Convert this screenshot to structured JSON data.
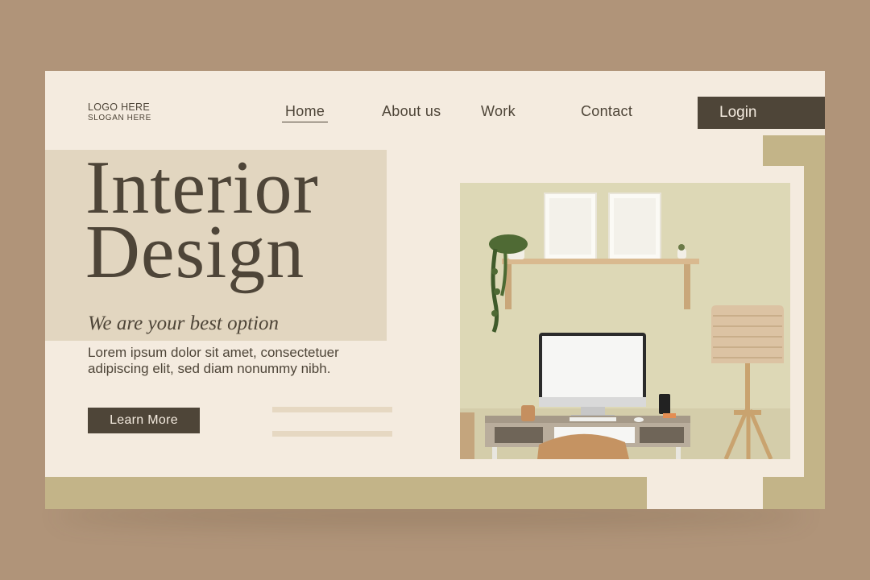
{
  "logo": {
    "line1": "LOGO HERE",
    "line2": "SLOGAN HERE"
  },
  "nav": {
    "home": "Home",
    "about": "About us",
    "work": "Work",
    "contact": "Contact"
  },
  "login_label": "Login",
  "hero": {
    "title_line1": "Interior",
    "title_line2": "Design",
    "tagline": "We are your best option",
    "description": "Lorem ipsum dolor sit amet, consectetuer adipiscing elit, sed diam nonummy nibh.",
    "cta_label": "Learn More"
  },
  "colors": {
    "background": "#b09479",
    "card": "#f4ebdf",
    "dark": "#4e4538",
    "olive": "#c3b488",
    "title_block": "#e2d6c0"
  }
}
